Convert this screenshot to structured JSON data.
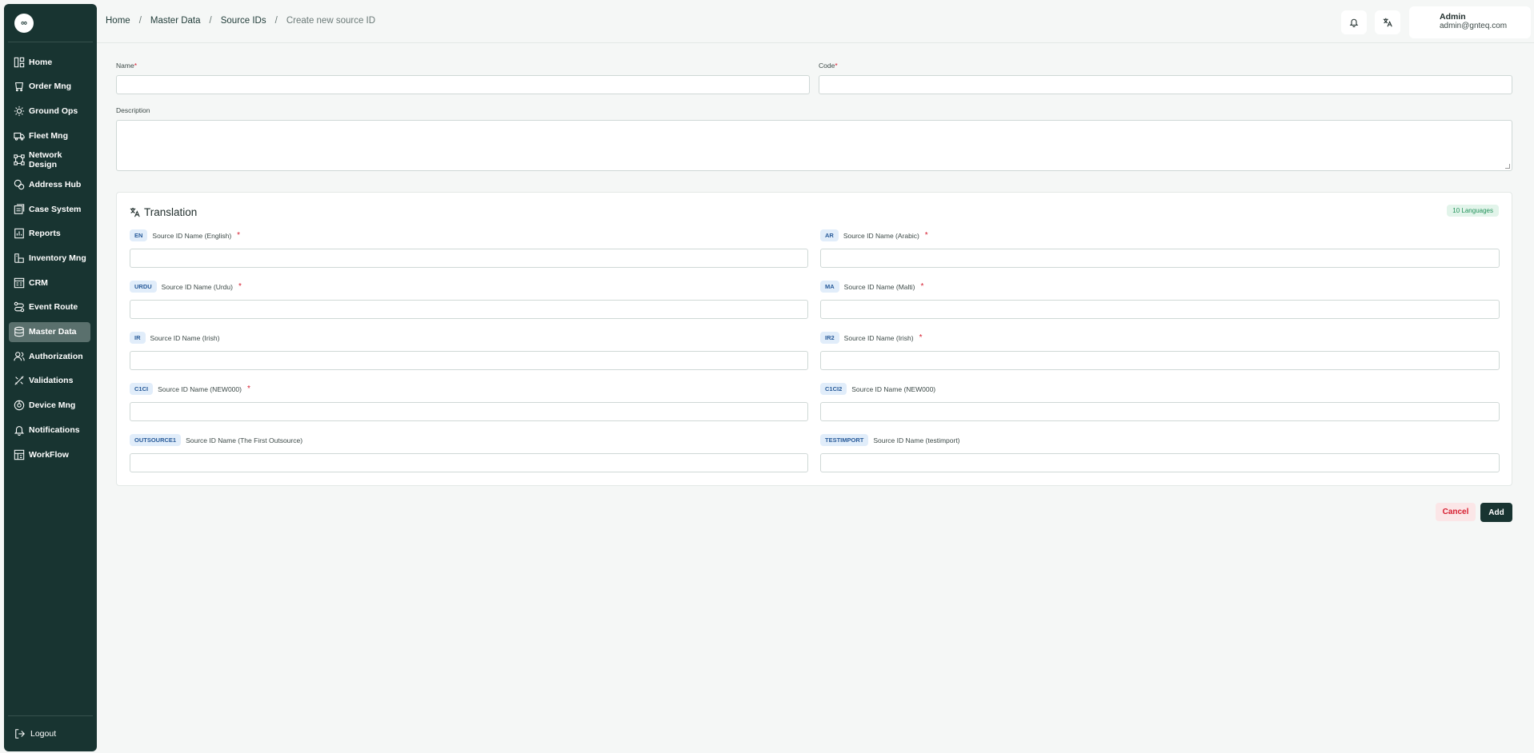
{
  "sidebar": {
    "logo": "∞",
    "items": [
      {
        "label": "Home",
        "icon": "home-icon"
      },
      {
        "label": "Order Mng",
        "icon": "order-icon"
      },
      {
        "label": "Ground Ops",
        "icon": "ground-ops-icon"
      },
      {
        "label": "Fleet Mng",
        "icon": "truck-icon"
      },
      {
        "label": "Network Design",
        "icon": "network-icon"
      },
      {
        "label": "Address Hub",
        "icon": "address-icon"
      },
      {
        "label": "Case System",
        "icon": "case-icon"
      },
      {
        "label": "Reports",
        "icon": "reports-icon"
      },
      {
        "label": "Inventory Mng",
        "icon": "inventory-icon"
      },
      {
        "label": "CRM",
        "icon": "crm-icon"
      },
      {
        "label": "Event Route",
        "icon": "route-icon"
      },
      {
        "label": "Master Data",
        "icon": "database-icon",
        "active": true
      },
      {
        "label": "Authorization",
        "icon": "users-icon"
      },
      {
        "label": "Validations",
        "icon": "validations-icon"
      },
      {
        "label": "Device Mng",
        "icon": "device-icon"
      },
      {
        "label": "Notifications",
        "icon": "bell-icon"
      },
      {
        "label": "WorkFlow",
        "icon": "workflow-icon"
      }
    ],
    "logout_label": "Logout"
  },
  "breadcrumb": {
    "home": "Home",
    "master_data": "Master Data",
    "source_ids": "Source IDs",
    "current": "Create new source ID",
    "separator": "/"
  },
  "user": {
    "name": "Admin",
    "email": "admin@gnteq.com"
  },
  "form": {
    "name_label": "Name",
    "code_label": "Code",
    "description_label": "Description",
    "required_mark": "*"
  },
  "translation": {
    "title": "Translation",
    "count": "10 Languages",
    "languages": [
      {
        "code": "EN",
        "label": "Source ID Name (English)",
        "required": true
      },
      {
        "code": "AR",
        "label": "Source ID Name (Arabic)",
        "required": true
      },
      {
        "code": "URDU",
        "label": "Source ID Name (Urdu)",
        "required": true
      },
      {
        "code": "MA",
        "label": "Source ID Name (Malti)",
        "required": true
      },
      {
        "code": "IR",
        "label": "Source ID Name (Irish)",
        "required": false
      },
      {
        "code": "IR2",
        "label": "Source ID Name (Irish)",
        "required": true
      },
      {
        "code": "C1CI",
        "label": "Source ID Name (NEW000)",
        "required": true
      },
      {
        "code": "C1CI2",
        "label": "Source ID Name (NEW000)",
        "required": false
      },
      {
        "code": "OUTSOURCE1",
        "label": "Source ID Name (The First Outsource)",
        "required": false
      },
      {
        "code": "TESTIMPORT",
        "label": "Source ID Name (testimport)",
        "required": false
      }
    ]
  },
  "actions": {
    "cancel": "Cancel",
    "add": "Add"
  },
  "colors": {
    "sidebar_bg": "#183431",
    "active_item": "#5a706d",
    "required": "#d61c2e",
    "badge_bg": "#e1edfa",
    "badge_text": "#275a99",
    "count_bg": "#e2f4ea",
    "count_text": "#22915a"
  }
}
